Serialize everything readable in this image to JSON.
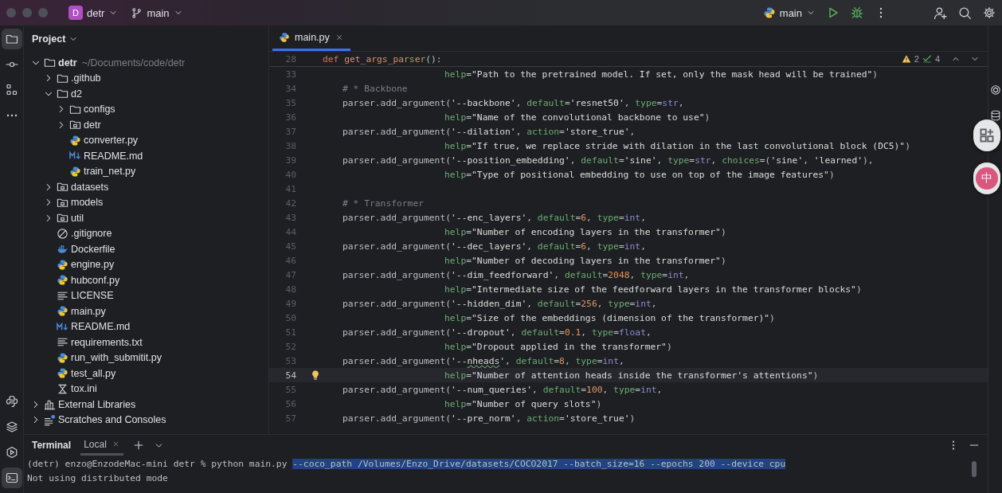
{
  "title_bar": {
    "project_badge": "D",
    "project": "detr",
    "branch": "main",
    "run_config": "main"
  },
  "left_toolbar": {
    "top": [
      {
        "kind": "project",
        "selected": true
      },
      {
        "kind": "commit",
        "selected": false
      },
      {
        "kind": "structure",
        "selected": false
      },
      {
        "kind": "more",
        "selected": false
      }
    ],
    "bottom": [
      {
        "kind": "python_console",
        "selected": false
      },
      {
        "kind": "layers",
        "selected": false
      },
      {
        "kind": "services",
        "selected": false
      },
      {
        "kind": "terminal",
        "selected": true
      }
    ]
  },
  "project_panel": {
    "title": "Project",
    "tree": [
      {
        "label": "detr",
        "kind": "folder",
        "hint": "~/Documents/code/detr",
        "expanded": true,
        "children": [
          {
            "label": ".github",
            "kind": "folder",
            "expanded": false
          },
          {
            "label": "d2",
            "kind": "folder",
            "expanded": true,
            "children": [
              {
                "label": "configs",
                "kind": "folder",
                "expanded": false
              },
              {
                "label": "detr",
                "kind": "package",
                "expanded": false
              },
              {
                "label": "converter.py",
                "kind": "python"
              },
              {
                "label": "README.md",
                "kind": "markdown"
              },
              {
                "label": "train_net.py",
                "kind": "python"
              }
            ]
          },
          {
            "label": "datasets",
            "kind": "package",
            "expanded": false
          },
          {
            "label": "models",
            "kind": "package",
            "expanded": false
          },
          {
            "label": "util",
            "kind": "package",
            "expanded": false
          },
          {
            "label": ".gitignore",
            "kind": "ignore"
          },
          {
            "label": "Dockerfile",
            "kind": "docker"
          },
          {
            "label": "engine.py",
            "kind": "python"
          },
          {
            "label": "hubconf.py",
            "kind": "python"
          },
          {
            "label": "LICENSE",
            "kind": "text"
          },
          {
            "label": "main.py",
            "kind": "python"
          },
          {
            "label": "README.md",
            "kind": "markdown"
          },
          {
            "label": "requirements.txt",
            "kind": "text"
          },
          {
            "label": "run_with_submitit.py",
            "kind": "python"
          },
          {
            "label": "test_all.py",
            "kind": "python"
          },
          {
            "label": "tox.ini",
            "kind": "tox"
          }
        ]
      },
      {
        "label": "External Libraries",
        "kind": "library",
        "expanded": false
      },
      {
        "label": "Scratches and Consoles",
        "kind": "scratches",
        "expanded": false
      }
    ]
  },
  "editor": {
    "tabs": [
      {
        "label": "main.py",
        "selected": true
      }
    ],
    "inspections": {
      "warnings": "2",
      "checks": "4"
    },
    "sticky": {
      "number": "28",
      "tokens": [
        {
          "kind": "kw",
          "text": "def "
        },
        {
          "kind": "fn",
          "text": "get_args_parser"
        },
        {
          "kind": "plain",
          "text": "():"
        }
      ]
    },
    "lines": [
      {
        "number": "33",
        "kind": "continuation",
        "current": false,
        "bulb": false,
        "tokens": [
          {
            "kind": "param",
            "text": "help"
          },
          {
            "kind": "plain",
            "text": "="
          },
          {
            "kind": "str",
            "text": "\"Path to the pretrained model. If set, only the mask head will be trained\""
          },
          {
            "kind": "plain",
            "text": ")"
          }
        ]
      },
      {
        "number": "34",
        "kind": "statement",
        "current": false,
        "bulb": false,
        "tokens": [
          {
            "kind": "comment",
            "text": "# * Backbone"
          }
        ]
      },
      {
        "number": "35",
        "kind": "statement",
        "current": false,
        "bulb": false,
        "tokens": [
          {
            "kind": "plain",
            "text": "parser.add_argument("
          },
          {
            "kind": "str",
            "text": "'--backbone'"
          },
          {
            "kind": "plain",
            "text": ", "
          },
          {
            "kind": "param",
            "text": "default"
          },
          {
            "kind": "plain",
            "text": "="
          },
          {
            "kind": "str",
            "text": "'resnet50'"
          },
          {
            "kind": "plain",
            "text": ", "
          },
          {
            "kind": "param",
            "text": "type"
          },
          {
            "kind": "plain",
            "text": "="
          },
          {
            "kind": "builtin",
            "text": "str"
          },
          {
            "kind": "plain",
            "text": ","
          }
        ]
      },
      {
        "number": "36",
        "kind": "continuation",
        "current": false,
        "bulb": false,
        "tokens": [
          {
            "kind": "param",
            "text": "help"
          },
          {
            "kind": "plain",
            "text": "="
          },
          {
            "kind": "str",
            "text": "\"Name of the convolutional backbone to use\""
          },
          {
            "kind": "plain",
            "text": ")"
          }
        ]
      },
      {
        "number": "37",
        "kind": "statement",
        "current": false,
        "bulb": false,
        "tokens": [
          {
            "kind": "plain",
            "text": "parser.add_argument("
          },
          {
            "kind": "str",
            "text": "'--dilation'"
          },
          {
            "kind": "plain",
            "text": ", "
          },
          {
            "kind": "param",
            "text": "action"
          },
          {
            "kind": "plain",
            "text": "="
          },
          {
            "kind": "str",
            "text": "'store_true'"
          },
          {
            "kind": "plain",
            "text": ","
          }
        ]
      },
      {
        "number": "38",
        "kind": "continuation",
        "current": false,
        "bulb": false,
        "tokens": [
          {
            "kind": "param",
            "text": "help"
          },
          {
            "kind": "plain",
            "text": "="
          },
          {
            "kind": "str",
            "text": "\"If true, we replace stride with dilation in the last convolutional block (DC5)\""
          },
          {
            "kind": "plain",
            "text": ")"
          }
        ]
      },
      {
        "number": "39",
        "kind": "statement",
        "current": false,
        "bulb": false,
        "tokens": [
          {
            "kind": "plain",
            "text": "parser.add_argument("
          },
          {
            "kind": "str",
            "text": "'--position_embedding'"
          },
          {
            "kind": "plain",
            "text": ", "
          },
          {
            "kind": "param",
            "text": "default"
          },
          {
            "kind": "plain",
            "text": "="
          },
          {
            "kind": "str",
            "text": "'sine'"
          },
          {
            "kind": "plain",
            "text": ", "
          },
          {
            "kind": "param",
            "text": "type"
          },
          {
            "kind": "plain",
            "text": "="
          },
          {
            "kind": "builtin",
            "text": "str"
          },
          {
            "kind": "plain",
            "text": ", "
          },
          {
            "kind": "param",
            "text": "choices"
          },
          {
            "kind": "plain",
            "text": "=("
          },
          {
            "kind": "str",
            "text": "'sine'"
          },
          {
            "kind": "plain",
            "text": ", "
          },
          {
            "kind": "str",
            "text": "'learned'"
          },
          {
            "kind": "plain",
            "text": "),"
          }
        ]
      },
      {
        "number": "40",
        "kind": "continuation",
        "current": false,
        "bulb": false,
        "tokens": [
          {
            "kind": "param",
            "text": "help"
          },
          {
            "kind": "plain",
            "text": "="
          },
          {
            "kind": "str",
            "text": "\"Type of positional embedding to use on top of the image features\""
          },
          {
            "kind": "plain",
            "text": ")"
          }
        ]
      },
      {
        "number": "41",
        "kind": "blank",
        "current": false,
        "bulb": false
      },
      {
        "number": "42",
        "kind": "statement",
        "current": false,
        "bulb": false,
        "tokens": [
          {
            "kind": "comment",
            "text": "# * Transformer"
          }
        ]
      },
      {
        "number": "43",
        "kind": "statement",
        "current": false,
        "bulb": false,
        "tokens": [
          {
            "kind": "plain",
            "text": "parser.add_argument("
          },
          {
            "kind": "str",
            "text": "'--enc_layers'"
          },
          {
            "kind": "plain",
            "text": ", "
          },
          {
            "kind": "param",
            "text": "default"
          },
          {
            "kind": "plain",
            "text": "="
          },
          {
            "kind": "number",
            "text": "6"
          },
          {
            "kind": "plain",
            "text": ", "
          },
          {
            "kind": "param",
            "text": "type"
          },
          {
            "kind": "plain",
            "text": "="
          },
          {
            "kind": "builtin",
            "text": "int"
          },
          {
            "kind": "plain",
            "text": ","
          }
        ]
      },
      {
        "number": "44",
        "kind": "continuation",
        "current": false,
        "bulb": false,
        "tokens": [
          {
            "kind": "param",
            "text": "help"
          },
          {
            "kind": "plain",
            "text": "="
          },
          {
            "kind": "str",
            "text": "\"Number of encoding layers in the transformer\""
          },
          {
            "kind": "plain",
            "text": ")"
          }
        ]
      },
      {
        "number": "45",
        "kind": "statement",
        "current": false,
        "bulb": false,
        "tokens": [
          {
            "kind": "plain",
            "text": "parser.add_argument("
          },
          {
            "kind": "str",
            "text": "'--dec_layers'"
          },
          {
            "kind": "plain",
            "text": ", "
          },
          {
            "kind": "param",
            "text": "default"
          },
          {
            "kind": "plain",
            "text": "="
          },
          {
            "kind": "number",
            "text": "6"
          },
          {
            "kind": "plain",
            "text": ", "
          },
          {
            "kind": "param",
            "text": "type"
          },
          {
            "kind": "plain",
            "text": "="
          },
          {
            "kind": "builtin",
            "text": "int"
          },
          {
            "kind": "plain",
            "text": ","
          }
        ]
      },
      {
        "number": "46",
        "kind": "continuation",
        "current": false,
        "bulb": false,
        "tokens": [
          {
            "kind": "param",
            "text": "help"
          },
          {
            "kind": "plain",
            "text": "="
          },
          {
            "kind": "str",
            "text": "\"Number of decoding layers in the transformer\""
          },
          {
            "kind": "plain",
            "text": ")"
          }
        ]
      },
      {
        "number": "47",
        "kind": "statement",
        "current": false,
        "bulb": false,
        "tokens": [
          {
            "kind": "plain",
            "text": "parser.add_argument("
          },
          {
            "kind": "str",
            "text": "'--dim_feedforward'"
          },
          {
            "kind": "plain",
            "text": ", "
          },
          {
            "kind": "param",
            "text": "default"
          },
          {
            "kind": "plain",
            "text": "="
          },
          {
            "kind": "number",
            "text": "2048"
          },
          {
            "kind": "plain",
            "text": ", "
          },
          {
            "kind": "param",
            "text": "type"
          },
          {
            "kind": "plain",
            "text": "="
          },
          {
            "kind": "builtin",
            "text": "int"
          },
          {
            "kind": "plain",
            "text": ","
          }
        ]
      },
      {
        "number": "48",
        "kind": "continuation",
        "current": false,
        "bulb": false,
        "tokens": [
          {
            "kind": "param",
            "text": "help"
          },
          {
            "kind": "plain",
            "text": "="
          },
          {
            "kind": "str",
            "text": "\"Intermediate size of the feedforward layers in the transformer blocks\""
          },
          {
            "kind": "plain",
            "text": ")"
          }
        ]
      },
      {
        "number": "49",
        "kind": "statement",
        "current": false,
        "bulb": false,
        "tokens": [
          {
            "kind": "plain",
            "text": "parser.add_argument("
          },
          {
            "kind": "str",
            "text": "'--hidden_dim'"
          },
          {
            "kind": "plain",
            "text": ", "
          },
          {
            "kind": "param",
            "text": "default"
          },
          {
            "kind": "plain",
            "text": "="
          },
          {
            "kind": "number",
            "text": "256"
          },
          {
            "kind": "plain",
            "text": ", "
          },
          {
            "kind": "param",
            "text": "type"
          },
          {
            "kind": "plain",
            "text": "="
          },
          {
            "kind": "builtin",
            "text": "int"
          },
          {
            "kind": "plain",
            "text": ","
          }
        ]
      },
      {
        "number": "50",
        "kind": "continuation",
        "current": false,
        "bulb": false,
        "tokens": [
          {
            "kind": "param",
            "text": "help"
          },
          {
            "kind": "plain",
            "text": "="
          },
          {
            "kind": "str",
            "text": "\"Size of the embeddings (dimension of the transformer)\""
          },
          {
            "kind": "plain",
            "text": ")"
          }
        ]
      },
      {
        "number": "51",
        "kind": "statement",
        "current": false,
        "bulb": false,
        "tokens": [
          {
            "kind": "plain",
            "text": "parser.add_argument("
          },
          {
            "kind": "str",
            "text": "'--dropout'"
          },
          {
            "kind": "plain",
            "text": ", "
          },
          {
            "kind": "param",
            "text": "default"
          },
          {
            "kind": "plain",
            "text": "="
          },
          {
            "kind": "number",
            "text": "0.1"
          },
          {
            "kind": "plain",
            "text": ", "
          },
          {
            "kind": "param",
            "text": "type"
          },
          {
            "kind": "plain",
            "text": "="
          },
          {
            "kind": "builtin",
            "text": "float"
          },
          {
            "kind": "plain",
            "text": ","
          }
        ]
      },
      {
        "number": "52",
        "kind": "continuation",
        "current": false,
        "bulb": false,
        "tokens": [
          {
            "kind": "param",
            "text": "help"
          },
          {
            "kind": "plain",
            "text": "="
          },
          {
            "kind": "str",
            "text": "\"Dropout applied in the transformer\""
          },
          {
            "kind": "plain",
            "text": ")"
          }
        ]
      },
      {
        "number": "53",
        "kind": "statement",
        "current": false,
        "bulb": false,
        "tokens": [
          {
            "kind": "plain",
            "text": "parser.add_argument("
          },
          {
            "kind": "str",
            "text": "'--"
          },
          {
            "kind": "typo",
            "text": "nheads"
          },
          {
            "kind": "str",
            "text": "'"
          },
          {
            "kind": "plain",
            "text": ", "
          },
          {
            "kind": "param",
            "text": "default"
          },
          {
            "kind": "plain",
            "text": "="
          },
          {
            "kind": "number",
            "text": "8"
          },
          {
            "kind": "plain",
            "text": ", "
          },
          {
            "kind": "param",
            "text": "type"
          },
          {
            "kind": "plain",
            "text": "="
          },
          {
            "kind": "builtin",
            "text": "int"
          },
          {
            "kind": "plain",
            "text": ","
          }
        ]
      },
      {
        "number": "54",
        "kind": "continuation",
        "current": true,
        "bulb": true,
        "tokens": [
          {
            "kind": "param",
            "text": "help"
          },
          {
            "kind": "plain",
            "text": "="
          },
          {
            "kind": "str",
            "text": "\"Number of attention heads inside the transformer's attentions\""
          },
          {
            "kind": "plain",
            "text": ")"
          }
        ]
      },
      {
        "number": "55",
        "kind": "statement",
        "current": false,
        "bulb": false,
        "tokens": [
          {
            "kind": "plain",
            "text": "parser.add_argument("
          },
          {
            "kind": "str",
            "text": "'--num_queries'"
          },
          {
            "kind": "plain",
            "text": ", "
          },
          {
            "kind": "param",
            "text": "default"
          },
          {
            "kind": "plain",
            "text": "="
          },
          {
            "kind": "number",
            "text": "100"
          },
          {
            "kind": "plain",
            "text": ", "
          },
          {
            "kind": "param",
            "text": "type"
          },
          {
            "kind": "plain",
            "text": "="
          },
          {
            "kind": "builtin",
            "text": "int"
          },
          {
            "kind": "plain",
            "text": ","
          }
        ]
      },
      {
        "number": "56",
        "kind": "continuation",
        "current": false,
        "bulb": false,
        "tokens": [
          {
            "kind": "param",
            "text": "help"
          },
          {
            "kind": "plain",
            "text": "="
          },
          {
            "kind": "str",
            "text": "\"Number of query slots\""
          },
          {
            "kind": "plain",
            "text": ")"
          }
        ]
      },
      {
        "number": "57",
        "kind": "statement",
        "current": false,
        "bulb": false,
        "tokens": [
          {
            "kind": "plain",
            "text": "parser.add_argument("
          },
          {
            "kind": "str",
            "text": "'--pre_norm'"
          },
          {
            "kind": "plain",
            "text": ", "
          },
          {
            "kind": "param",
            "text": "action"
          },
          {
            "kind": "plain",
            "text": "="
          },
          {
            "kind": "str",
            "text": "'store_true'"
          },
          {
            "kind": "plain",
            "text": ")"
          }
        ]
      }
    ]
  },
  "terminal": {
    "title": "Terminal",
    "tabs": [
      {
        "label": "Local",
        "selected": true
      }
    ],
    "lines": [
      {
        "segments": [
          {
            "text": "(detr) enzo@EnzodeMac-mini detr % python main.py ",
            "selected": false
          },
          {
            "text": "--coco_path /Volumes/Enzo_Drive/datasets/COCO2017 --batch_size=16 --epochs 200 --device cpu",
            "selected": true
          }
        ]
      },
      {
        "segments": [
          {
            "text": "Not using distributed mode",
            "selected": false
          }
        ]
      }
    ]
  },
  "floating_buttons": [
    {
      "kind": "apps"
    },
    {
      "kind": "translate",
      "glyph": "中"
    }
  ]
}
